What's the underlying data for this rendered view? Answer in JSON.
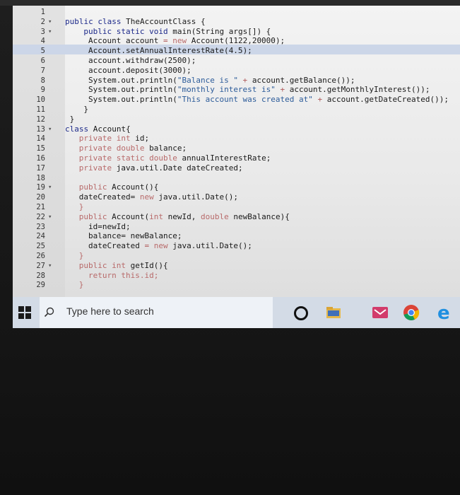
{
  "editor": {
    "lines": [
      {
        "n": "1",
        "fold": "",
        "indent": 0,
        "tokens": []
      },
      {
        "n": "2",
        "fold": "▾",
        "indent": 0,
        "tokens": [
          [
            "kw",
            "public class "
          ],
          [
            "fn",
            "TheAccountClass {"
          ]
        ]
      },
      {
        "n": "3",
        "fold": "▾",
        "indent": 4,
        "tokens": [
          [
            "kw",
            "public static void "
          ],
          [
            "fn",
            "main(String args[]) {"
          ]
        ]
      },
      {
        "n": "4",
        "fold": "",
        "indent": 5,
        "tokens": [
          [
            "fn",
            "Account account "
          ],
          [
            "plus",
            "= "
          ],
          [
            "kw2",
            "new "
          ],
          [
            "fn",
            "Account("
          ],
          [
            "num",
            "1122,20000"
          ],
          [
            "fn",
            ");"
          ]
        ]
      },
      {
        "n": "5",
        "fold": "",
        "indent": 5,
        "tokens": [
          [
            "fn",
            "Account.setAnnualInterestRate("
          ],
          [
            "num",
            "4.5"
          ],
          [
            "fn",
            ");"
          ]
        ]
      },
      {
        "n": "6",
        "fold": "",
        "indent": 5,
        "tokens": [
          [
            "fn",
            "account.withdraw("
          ],
          [
            "num",
            "2500"
          ],
          [
            "fn",
            ");"
          ]
        ]
      },
      {
        "n": "7",
        "fold": "",
        "indent": 5,
        "tokens": [
          [
            "fn",
            "account.deposit("
          ],
          [
            "num",
            "3000"
          ],
          [
            "fn",
            ");"
          ]
        ]
      },
      {
        "n": "8",
        "fold": "",
        "indent": 5,
        "tokens": [
          [
            "fn",
            "System.out.println("
          ],
          [
            "str",
            "\"Balance is \""
          ],
          [
            "plus",
            " + "
          ],
          [
            "fn",
            "account.getBalance());"
          ]
        ]
      },
      {
        "n": "9",
        "fold": "",
        "indent": 5,
        "tokens": [
          [
            "fn",
            "System.out.println("
          ],
          [
            "str",
            "\"monthly interest is\""
          ],
          [
            "plus",
            " + "
          ],
          [
            "fn",
            "account.getMonthlyInterest());"
          ]
        ]
      },
      {
        "n": "10",
        "fold": "",
        "indent": 5,
        "tokens": [
          [
            "fn",
            "System.out.println("
          ],
          [
            "str",
            "\"This account was created at\""
          ],
          [
            "plus",
            " + "
          ],
          [
            "fn",
            "account.getDateCreated());"
          ]
        ]
      },
      {
        "n": "11",
        "fold": "",
        "indent": 4,
        "tokens": [
          [
            "fn",
            "}"
          ]
        ]
      },
      {
        "n": "12",
        "fold": "",
        "indent": 1,
        "tokens": [
          [
            "fn",
            "}"
          ]
        ]
      },
      {
        "n": "13",
        "fold": "▾",
        "indent": 0,
        "tokens": [
          [
            "kw",
            "class "
          ],
          [
            "fn",
            "Account{"
          ]
        ]
      },
      {
        "n": "14",
        "fold": "",
        "indent": 3,
        "tokens": [
          [
            "kw2",
            "private int "
          ],
          [
            "fn",
            "id;"
          ]
        ]
      },
      {
        "n": "15",
        "fold": "",
        "indent": 3,
        "tokens": [
          [
            "kw2",
            "private double "
          ],
          [
            "fn",
            "balance;"
          ]
        ]
      },
      {
        "n": "16",
        "fold": "",
        "indent": 3,
        "tokens": [
          [
            "kw2",
            "private static double "
          ],
          [
            "fn",
            "annualInterestRate;"
          ]
        ]
      },
      {
        "n": "17",
        "fold": "",
        "indent": 3,
        "tokens": [
          [
            "kw2",
            "private "
          ],
          [
            "fn",
            "java.util.Date dateCreated;"
          ]
        ]
      },
      {
        "n": "18",
        "fold": "",
        "indent": 0,
        "tokens": []
      },
      {
        "n": "19",
        "fold": "▾",
        "indent": 3,
        "tokens": [
          [
            "kw2",
            "public "
          ],
          [
            "fn",
            "Account(){"
          ]
        ]
      },
      {
        "n": "20",
        "fold": "",
        "indent": 3,
        "tokens": [
          [
            "fn",
            "dateCreated= "
          ],
          [
            "kw2",
            "new "
          ],
          [
            "fn",
            "java.util.Date();"
          ]
        ]
      },
      {
        "n": "21",
        "fold": "",
        "indent": 3,
        "tokens": [
          [
            "kw2",
            "}"
          ]
        ]
      },
      {
        "n": "22",
        "fold": "▾",
        "indent": 3,
        "tokens": [
          [
            "kw2",
            "public "
          ],
          [
            "fn",
            "Account("
          ],
          [
            "kw2",
            "int "
          ],
          [
            "fn",
            "newId, "
          ],
          [
            "kw2",
            "double "
          ],
          [
            "fn",
            "newBalance){"
          ]
        ]
      },
      {
        "n": "23",
        "fold": "",
        "indent": 5,
        "tokens": [
          [
            "fn",
            "id=newId;"
          ]
        ]
      },
      {
        "n": "24",
        "fold": "",
        "indent": 5,
        "tokens": [
          [
            "fn",
            "balance= newBalance;"
          ]
        ]
      },
      {
        "n": "25",
        "fold": "",
        "indent": 5,
        "tokens": [
          [
            "fn",
            "dateCreated "
          ],
          [
            "plus",
            "= "
          ],
          [
            "kw2",
            "new "
          ],
          [
            "fn",
            "java.util.Date();"
          ]
        ]
      },
      {
        "n": "26",
        "fold": "",
        "indent": 3,
        "tokens": [
          [
            "kw2",
            "}"
          ]
        ]
      },
      {
        "n": "27",
        "fold": "▾",
        "indent": 3,
        "tokens": [
          [
            "kw2",
            "public int "
          ],
          [
            "fn",
            "getId(){"
          ]
        ]
      },
      {
        "n": "28",
        "fold": "",
        "indent": 5,
        "tokens": [
          [
            "kw2",
            "return this.id;"
          ]
        ]
      },
      {
        "n": "29",
        "fold": "",
        "indent": 3,
        "tokens": [
          [
            "kw2",
            "}"
          ]
        ]
      }
    ]
  },
  "taskbar": {
    "search_placeholder": "Type here to search",
    "icons": [
      "windows-icon",
      "search-icon",
      "cortana-icon",
      "file-explorer-icon",
      "mail-icon",
      "chrome-icon",
      "edge-icon"
    ]
  },
  "colors": {
    "keyword": "#1d2a8a",
    "modifier": "#b86a6a",
    "string": "#2d5c9a",
    "highlight": "#ccd6e8",
    "taskbar": "#d3dbe6"
  }
}
